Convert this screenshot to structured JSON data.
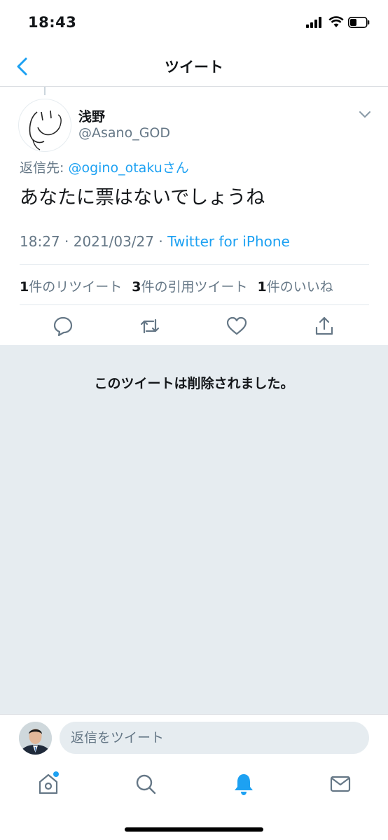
{
  "status_bar": {
    "time": "18:43"
  },
  "nav": {
    "title": "ツイート"
  },
  "tweet": {
    "display_name": "浅野",
    "handle": "@Asano_GOD",
    "reply_prefix": "返信先: ",
    "reply_mention": "@ogino_otaku",
    "reply_suffix": "さん",
    "text": "あなたに票はないでしょうね",
    "time": "18:27",
    "date": "2021/03/27",
    "separator": " · ",
    "source": "Twitter for iPhone",
    "retweet_count": "1",
    "retweet_label": "件のリツイート",
    "quote_count": "3",
    "quote_label": "件の引用ツイート",
    "like_count": "1",
    "like_label": "件のいいね"
  },
  "deleted_notice": "このツイートは削除されました。",
  "reply_bar": {
    "placeholder": "返信をツイート"
  },
  "tab_bar": {
    "items": [
      "home-icon",
      "search-icon",
      "notifications-icon",
      "messages-icon"
    ],
    "active": "notifications-icon"
  },
  "colors": {
    "accent": "#1da1f2",
    "secondary_text": "#657786",
    "deleted_bg": "#e6ecf0"
  }
}
